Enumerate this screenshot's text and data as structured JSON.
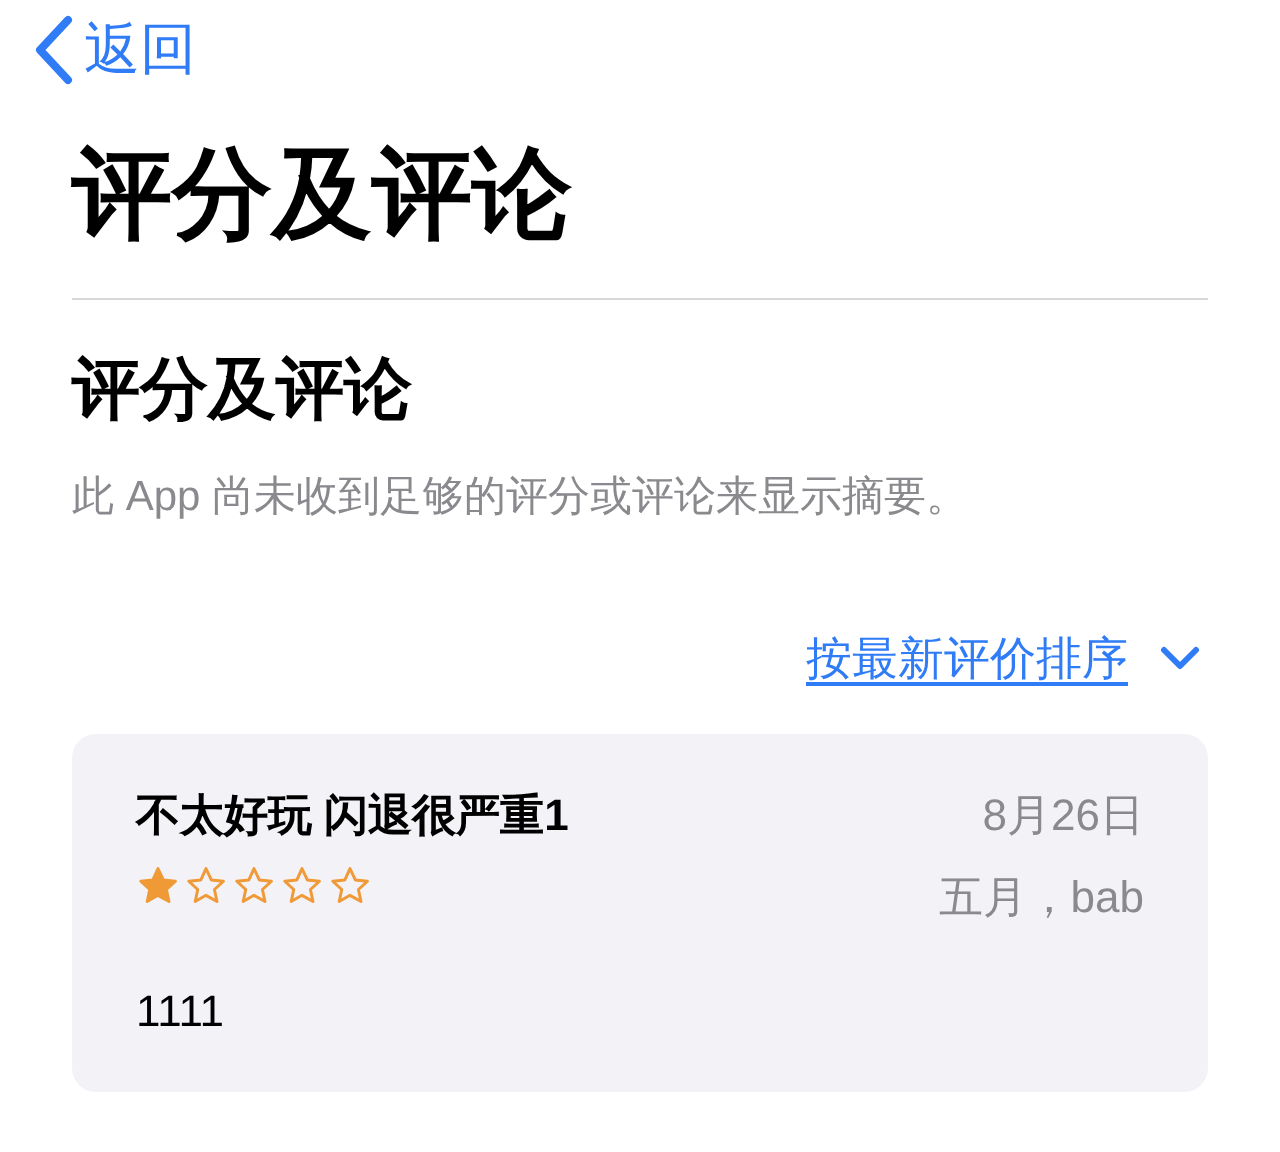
{
  "nav": {
    "back": "返回"
  },
  "title": "评分及评论",
  "section": {
    "heading": "评分及评论",
    "note": "此 App 尚未收到足够的评分或评论来显示摘要。"
  },
  "sort": {
    "label": "按最新评价排序"
  },
  "reviews": [
    {
      "title": "不太好玩 闪退很严重1",
      "date": "8月26日",
      "author": "五月，bab",
      "stars": 1,
      "body": "1111"
    }
  ]
}
